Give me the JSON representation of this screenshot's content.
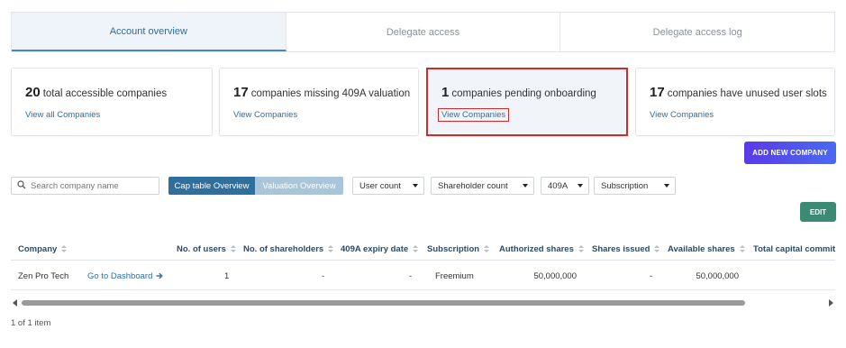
{
  "tabs": [
    {
      "label": "Account overview",
      "active": true
    },
    {
      "label": "Delegate access",
      "active": false
    },
    {
      "label": "Delegate access log",
      "active": false
    }
  ],
  "cards": [
    {
      "count": "20",
      "text": "total accessible companies",
      "link": "View all Companies"
    },
    {
      "count": "17",
      "text": "companies missing 409A valuation",
      "link": "View Companies"
    },
    {
      "count": "1",
      "text": "companies pending onboarding",
      "link": "View Companies"
    },
    {
      "count": "17",
      "text": "companies have unused user slots",
      "link": "View Companies"
    }
  ],
  "actions": {
    "add_company": "ADD NEW COMPANY",
    "edit": "EDIT"
  },
  "filters": {
    "search_placeholder": "Search company name",
    "search_value": "",
    "view_toggle": [
      "Cap table Overview",
      "Valuation Overview"
    ],
    "view_selected": "Cap table Overview",
    "dropdowns": [
      "User count",
      "Shareholder count",
      "409A",
      "Subscription"
    ]
  },
  "table": {
    "columns": [
      "Company",
      "No. of users",
      "No. of shareholders",
      "409A expiry date",
      "Subscription",
      "Authorized shares",
      "Shares issued",
      "Available shares",
      "Total capital commit"
    ],
    "rows": [
      {
        "company": "Zen Pro Tech",
        "dashboard_link": "Go to Dashboard",
        "users": "1",
        "shareholders": "-",
        "expiry": "-",
        "subscription": "Freemium",
        "authorized": "50,000,000",
        "issued": "-",
        "available": "50,000,000"
      }
    ]
  },
  "scroll_position": 0,
  "footer": "1 of 1 item",
  "colors": {
    "primary": "#2f6f9e",
    "highlight": "#d12a2a",
    "add_button": "#5b3ae6",
    "edit_button": "#3a8a74"
  },
  "icons": [
    "search-icon",
    "arrow-right-icon",
    "caret-down-icon",
    "sort-icon",
    "scroll-left-icon",
    "scroll-right-icon"
  ]
}
